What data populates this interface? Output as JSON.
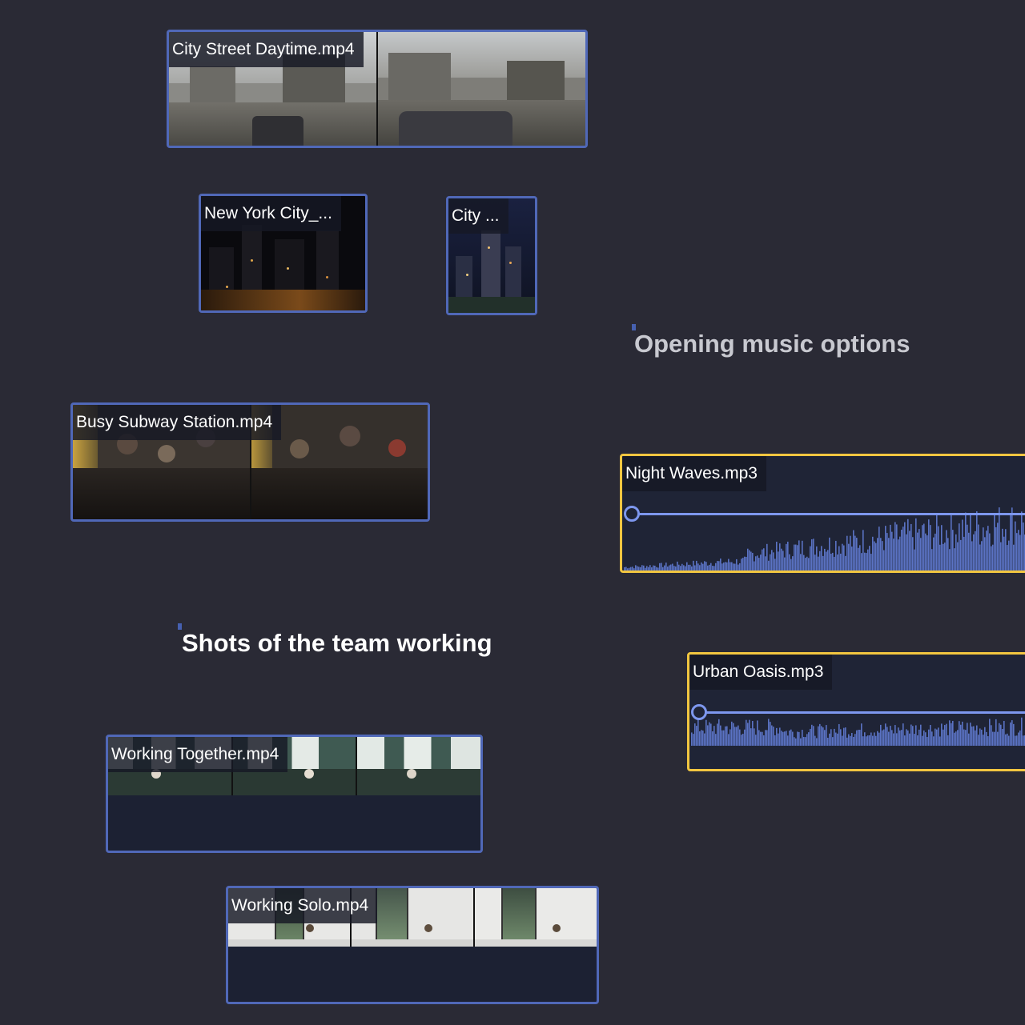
{
  "clips": {
    "city_street_daytime": {
      "name": "City Street Daytime.mp4"
    },
    "new_york_city": {
      "name": "New York City_..."
    },
    "city_short": {
      "name": "City ..."
    },
    "busy_subway": {
      "name": "Busy Subway Station.mp4"
    },
    "working_together": {
      "name": "Working Together.mp4"
    },
    "working_solo": {
      "name": "Working Solo.mp4"
    }
  },
  "audio": {
    "night_waves": {
      "name": "Night Waves.mp3"
    },
    "urban_oasis": {
      "name": "Urban Oasis.mp3"
    }
  },
  "notes": {
    "opening_music": "Opening music options",
    "team_working": "Shots of the team working"
  },
  "colors": {
    "canvas_background": "#2a2a35",
    "video_border": "#5068b8",
    "audio_border": "#f2c640",
    "waveform": "#5b73c4",
    "volume_line": "#7d97ee",
    "note_text_white": "#ffffff",
    "note_text_gray": "#c8c9d0"
  },
  "icons": {
    "volume_handle": "volume-handle-icon",
    "note_marker": "note-marker-icon"
  }
}
